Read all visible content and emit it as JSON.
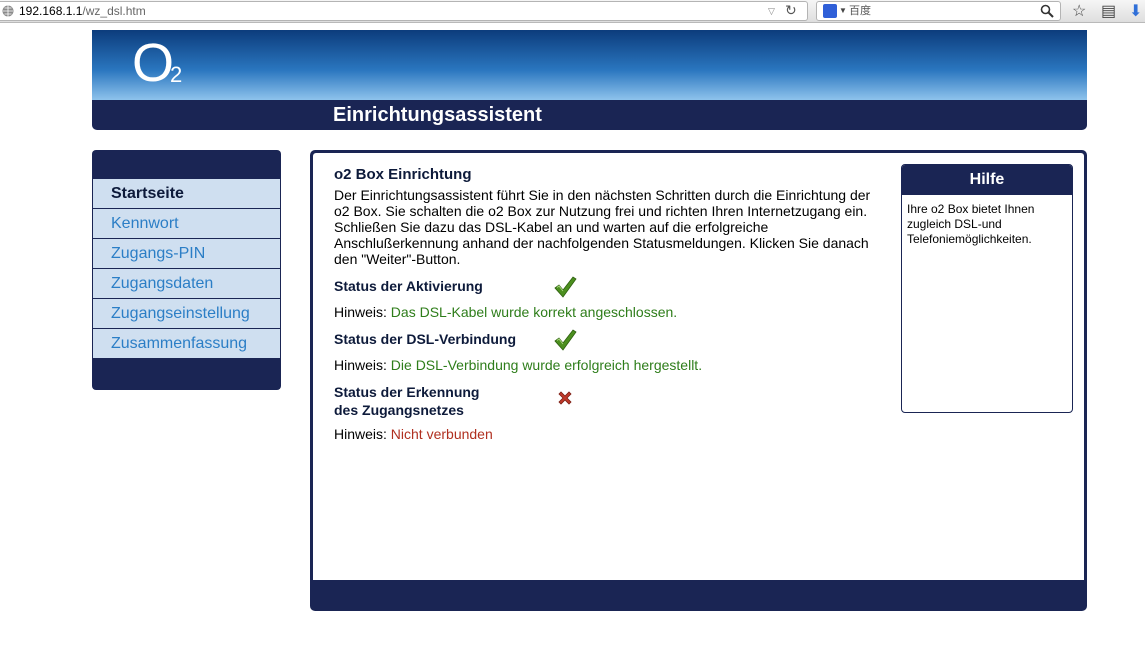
{
  "browser": {
    "url_host": "192.168.1.1",
    "url_path": "/wz_dsl.htm",
    "search_engine": "百度"
  },
  "header": {
    "logo": "O",
    "logo_sub": "2",
    "title": "Einrichtungsassistent"
  },
  "sidebar": {
    "items": [
      {
        "label": "Startseite",
        "active": true
      },
      {
        "label": "Kennwort"
      },
      {
        "label": "Zugangs-PIN"
      },
      {
        "label": "Zugangsdaten"
      },
      {
        "label": "Zugangseinstellung"
      },
      {
        "label": "Zusammenfassung"
      }
    ]
  },
  "main": {
    "title": "o2 Box Einrichtung",
    "intro": "Der Einrichtungsassistent führt Sie in den nächsten Schritten durch die Einrichtung der o2 Box. Sie schalten die o2 Box zur Nutzung frei und richten Ihren Internetzugang ein. Schließen Sie dazu das DSL-Kabel an und warten auf die erfolgreiche Anschlußerkennung anhand der nachfolgenden Statusmeldungen. Klicken Sie danach den \"Weiter\"-Button.",
    "hint_prefix": "Hinweis: ",
    "statuses": [
      {
        "label": "Status der Aktivierung",
        "state": "ok",
        "hint": "Das DSL-Kabel wurde korrekt angeschlossen."
      },
      {
        "label": "Status der DSL-Verbindung",
        "state": "ok",
        "hint": "Die DSL-Verbindung wurde erfolgreich hergestellt."
      },
      {
        "label_line1": "Status der Erkennung",
        "label_line2": "des Zugangsnetzes",
        "state": "error",
        "hint": "Nicht verbunden"
      }
    ]
  },
  "help": {
    "title": "Hilfe",
    "text": "Ihre o2 Box bietet Ihnen zugleich DSL-und Telefoniemöglichkeiten."
  },
  "colors": {
    "navy": "#1a2554",
    "ok": "#2e7d1a",
    "error": "#b03020",
    "link": "#2b7ec6"
  }
}
